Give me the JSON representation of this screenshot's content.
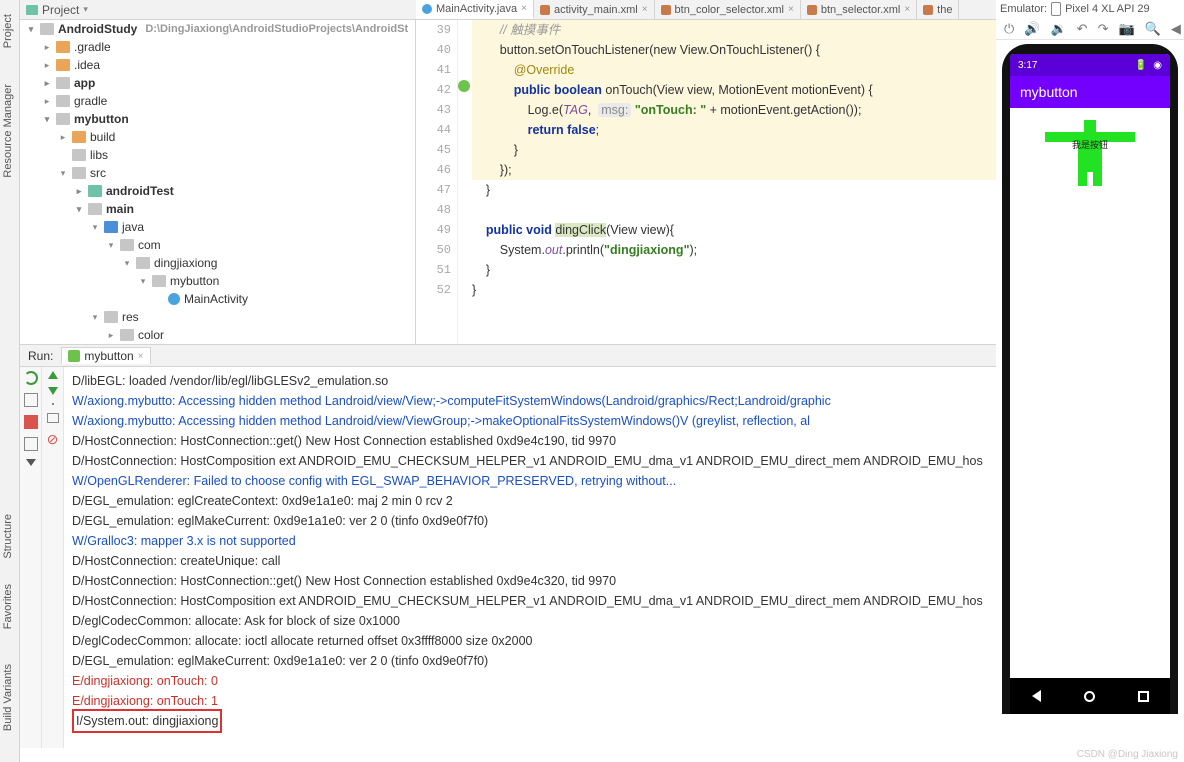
{
  "left_tabs": {
    "project": "Project",
    "resource_manager": "Resource Manager",
    "structure": "Structure",
    "favorites": "Favorites",
    "build_variants": "Build Variants"
  },
  "project_header": {
    "label": "Project"
  },
  "editor_tabs": [
    {
      "label": "MainActivity.java",
      "type": "java",
      "active": true
    },
    {
      "label": "activity_main.xml",
      "type": "xml"
    },
    {
      "label": "btn_color_selector.xml",
      "type": "xml"
    },
    {
      "label": "btn_selector.xml",
      "type": "xml"
    },
    {
      "label": "the",
      "type": "xml"
    }
  ],
  "emulator": {
    "title": "Emulator:",
    "device": "Pixel 4 XL API 29"
  },
  "tree": {
    "root": "AndroidStudy",
    "root_path": "D:\\DingJiaxiong\\AndroidStudioProjects\\AndroidSt",
    "gradle_folder": ".gradle",
    "idea": ".idea",
    "app": "app",
    "gradle": "gradle",
    "mybutton": "mybutton",
    "build": "build",
    "libs": "libs",
    "src": "src",
    "androidTest": "androidTest",
    "main": "main",
    "java": "java",
    "com": "com",
    "dingjiaxiong": "dingjiaxiong",
    "mybutton_pkg": "mybutton",
    "main_activity": "MainActivity",
    "res": "res",
    "color": "color"
  },
  "code": {
    "lines": {
      "39": "// 触摸事件",
      "40": "button.setOnTouchListener(new View.OnTouchListener() {",
      "41": "@Override",
      "42": "public boolean onTouch(View view, MotionEvent motionEvent) {",
      "43_a": "Log.e(",
      "43_tag": "TAG",
      "43_hint": "msg:",
      "43_str": "\"onTouch: \"",
      "43_b": " + motionEvent.getAction());",
      "44": "return false;",
      "45": "}",
      "46": "});",
      "47": "}",
      "49": "public void dingClick(View view){",
      "50_a": "System.",
      "50_out": "out",
      "50_b": ".println(",
      "50_str": "\"dingjiaxiong\"",
      "50_c": ");",
      "51": "}",
      "52": "}"
    },
    "line_numbers": [
      "39",
      "40",
      "41",
      "42",
      "43",
      "44",
      "45",
      "46",
      "47",
      "48",
      "49",
      "50",
      "51",
      "52"
    ]
  },
  "phone": {
    "time": "3:17",
    "app_title": "mybutton",
    "button_label": "我是按钮"
  },
  "run": {
    "label": "Run:",
    "tab": "mybutton",
    "logs": [
      {
        "lvl": "d",
        "txt": "D/libEGL: loaded /vendor/lib/egl/libGLESv2_emulation.so"
      },
      {
        "lvl": "w",
        "txt": "W/axiong.mybutto: Accessing hidden method Landroid/view/View;->computeFitSystemWindows(Landroid/graphics/Rect;Landroid/graphic"
      },
      {
        "lvl": "w",
        "txt": "W/axiong.mybutto: Accessing hidden method Landroid/view/ViewGroup;->makeOptionalFitsSystemWindows()V (greylist, reflection, al"
      },
      {
        "lvl": "d",
        "txt": "D/HostConnection: HostConnection::get() New Host Connection established 0xd9e4c190, tid 9970"
      },
      {
        "lvl": "d",
        "txt": "D/HostConnection: HostComposition ext ANDROID_EMU_CHECKSUM_HELPER_v1 ANDROID_EMU_dma_v1 ANDROID_EMU_direct_mem ANDROID_EMU_hos"
      },
      {
        "lvl": "w",
        "txt": "W/OpenGLRenderer: Failed to choose config with EGL_SWAP_BEHAVIOR_PRESERVED, retrying without..."
      },
      {
        "lvl": "d",
        "txt": "D/EGL_emulation: eglCreateContext: 0xd9e1a1e0: maj 2 min 0 rcv 2"
      },
      {
        "lvl": "d",
        "txt": "D/EGL_emulation: eglMakeCurrent: 0xd9e1a1e0: ver 2 0 (tinfo 0xd9e0f7f0)"
      },
      {
        "lvl": "w",
        "txt": "W/Gralloc3: mapper 3.x is not supported"
      },
      {
        "lvl": "d",
        "txt": "D/HostConnection: createUnique: call"
      },
      {
        "lvl": "d",
        "txt": "D/HostConnection: HostConnection::get() New Host Connection established 0xd9e4c320, tid 9970"
      },
      {
        "lvl": "d",
        "txt": "D/HostConnection: HostComposition ext ANDROID_EMU_CHECKSUM_HELPER_v1 ANDROID_EMU_dma_v1 ANDROID_EMU_direct_mem ANDROID_EMU_hos"
      },
      {
        "lvl": "d",
        "txt": "D/eglCodecCommon: allocate: Ask for block of size 0x1000"
      },
      {
        "lvl": "d",
        "txt": "D/eglCodecCommon: allocate: ioctl allocate returned offset 0x3ffff8000 size 0x2000"
      },
      {
        "lvl": "d",
        "txt": "D/EGL_emulation: eglMakeCurrent: 0xd9e1a1e0: ver 2 0 (tinfo 0xd9e0f7f0)"
      },
      {
        "lvl": "e",
        "txt": "E/dingjiaxiong: onTouch: 0"
      },
      {
        "lvl": "e",
        "txt": "E/dingjiaxiong: onTouch: 1"
      },
      {
        "lvl": "i",
        "txt": "I/System.out: dingjiaxiong",
        "boxed": true
      }
    ]
  },
  "watermark": "CSDN @Ding Jiaxiong"
}
